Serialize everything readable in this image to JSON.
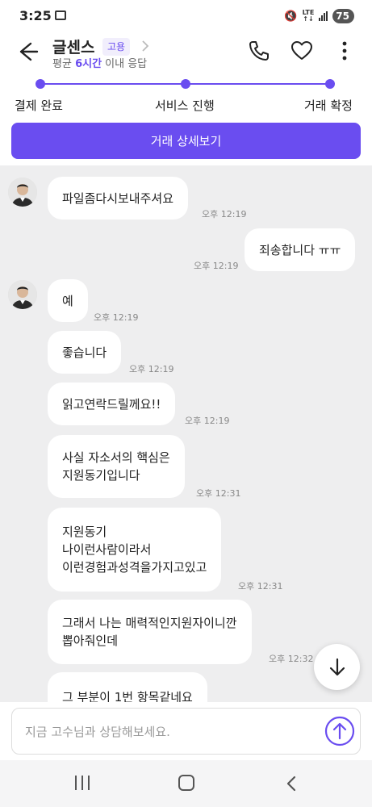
{
  "status_bar": {
    "time": "3:25",
    "network": "LTE",
    "battery": "75"
  },
  "header": {
    "title": "글센스",
    "badge": "고용",
    "response_prefix": "평균 ",
    "response_highlight": "6시간",
    "response_suffix": " 이내 응답",
    "accent_color": "#6a4df0"
  },
  "progress": {
    "steps": [
      {
        "label": "결제 완료"
      },
      {
        "label": "서비스 진행"
      },
      {
        "label": "거래 확정"
      }
    ]
  },
  "detail_button": "거래 상세보기",
  "messages": [
    {
      "side": "left",
      "avatar": true,
      "lines": [
        "파일좀다시보내주셔요"
      ],
      "time": "오후 12:19"
    },
    {
      "side": "right",
      "lines": [
        "죄송합니다 ㅠㅠ"
      ],
      "time": "오후 12:19"
    },
    {
      "side": "left",
      "avatar": true,
      "lines": [
        "예"
      ],
      "time": "오후 12:19"
    },
    {
      "side": "left",
      "lines": [
        "좋습니다"
      ],
      "time": "오후 12:19"
    },
    {
      "side": "left",
      "lines": [
        "읽고연락드릴께요!!"
      ],
      "time": "오후 12:19"
    },
    {
      "side": "left",
      "lines": [
        "사실 자소서의 핵심은",
        "지원동기입니다"
      ],
      "time": "오후 12:31"
    },
    {
      "side": "left",
      "lines": [
        "지원동기",
        "나이런사람이라서",
        "이런경험과성격을가지고있고"
      ],
      "time": "오후 12:31"
    },
    {
      "side": "left",
      "lines": [
        "그래서 나는 매력적인지원자이니깐",
        "뽑아줘인데"
      ],
      "time": "오후 12:32"
    },
    {
      "side": "left",
      "lines": [
        "그 부분이 1번 항목같네요"
      ],
      "time": ""
    }
  ],
  "input": {
    "placeholder": "지금 고수님과 상담해보세요."
  },
  "icons": [
    "back-arrow-icon",
    "chevron-right-icon",
    "phone-icon",
    "heart-icon",
    "more-vertical-icon",
    "arrow-down-icon",
    "send-arrow-up-icon",
    "recent-apps-icon",
    "home-icon",
    "nav-back-icon"
  ]
}
